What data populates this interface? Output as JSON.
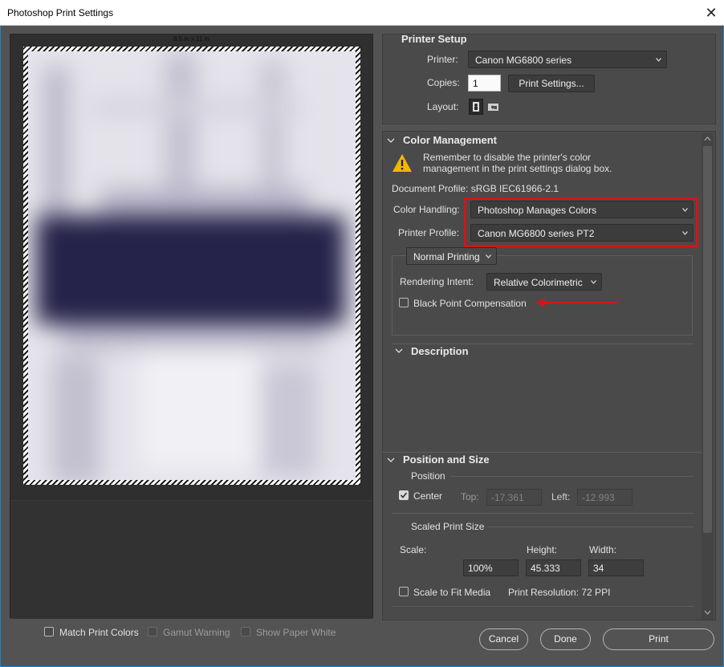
{
  "window": {
    "title": "Photoshop Print Settings"
  },
  "preview": {
    "paper_size": "8.5 in x 11 in"
  },
  "printer_setup": {
    "title": "Printer Setup",
    "printer_label": "Printer:",
    "printer_value": "Canon MG6800 series",
    "copies_label": "Copies:",
    "copies_value": "1",
    "print_settings_button": "Print Settings...",
    "layout_label": "Layout:"
  },
  "color_management": {
    "title": "Color Management",
    "warning_line1": "Remember to disable the printer's color",
    "warning_line2": "management in the print settings dialog box.",
    "document_profile": "Document Profile: sRGB IEC61966-2.1",
    "color_handling_label": "Color Handling:",
    "color_handling_value": "Photoshop Manages Colors",
    "printer_profile_label": "Printer Profile:",
    "printer_profile_value": "Canon MG6800 series PT2",
    "printing_mode": "Normal Printing",
    "rendering_intent_label": "Rendering Intent:",
    "rendering_intent_value": "Relative Colorimetric",
    "black_point_label": "Black Point Compensation"
  },
  "description": {
    "title": "Description"
  },
  "position_size": {
    "title": "Position and Size",
    "position_label": "Position",
    "center_label": "Center",
    "top_label": "Top:",
    "top_value": "-17.361",
    "left_label": "Left:",
    "left_value": "-12.993",
    "scaled_label": "Scaled Print Size",
    "scale_label": "Scale:",
    "height_label": "Height:",
    "width_label": "Width:",
    "scale_value": "100%",
    "height_value": "45.333",
    "width_value": "34",
    "scale_to_fit_label": "Scale to Fit Media",
    "print_resolution": "Print Resolution: 72 PPI"
  },
  "footer": {
    "match_print_colors": "Match Print Colors",
    "gamut_warning": "Gamut Warning",
    "show_paper_white": "Show Paper White",
    "cancel": "Cancel",
    "done": "Done",
    "print": "Print"
  },
  "colors": {
    "accent_red": "#d0161b",
    "warning_yellow": "#f2b705",
    "window_border": "#1e84d0"
  }
}
